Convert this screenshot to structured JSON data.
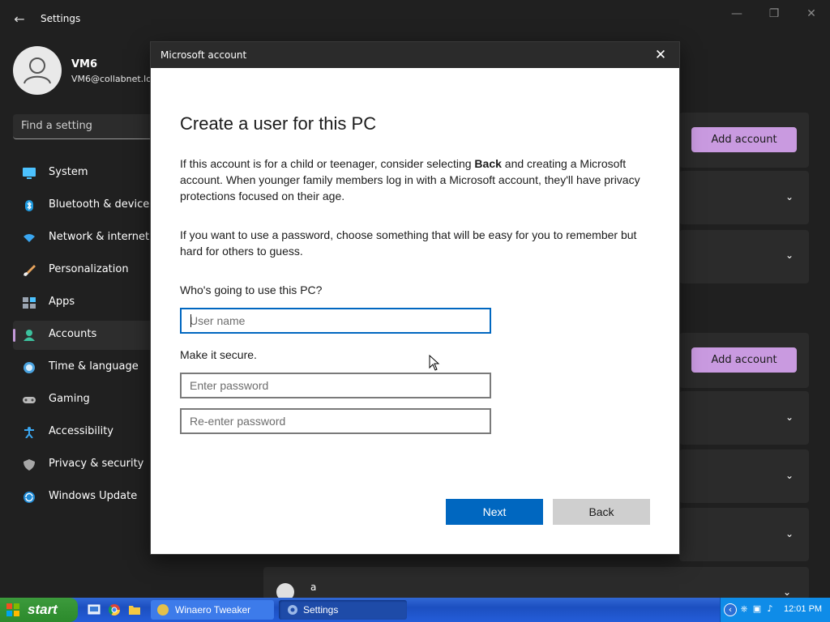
{
  "window": {
    "title": "Settings",
    "back_icon": "back-arrow-icon"
  },
  "profile": {
    "name": "VM6",
    "email": "VM6@collabnet.lo"
  },
  "search": {
    "placeholder": "Find a setting"
  },
  "sidebar": {
    "active_indicator_color": "#c39ad9",
    "items": [
      {
        "label": "System",
        "icon": "system-icon"
      },
      {
        "label": "Bluetooth & devices",
        "icon": "bluetooth-icon"
      },
      {
        "label": "Network & internet",
        "icon": "network-icon"
      },
      {
        "label": "Personalization",
        "icon": "personalization-icon"
      },
      {
        "label": "Apps",
        "icon": "apps-icon"
      },
      {
        "label": "Accounts",
        "icon": "accounts-icon",
        "active": true
      },
      {
        "label": "Time & language",
        "icon": "time-icon"
      },
      {
        "label": "Gaming",
        "icon": "gaming-icon"
      },
      {
        "label": "Accessibility",
        "icon": "accessibility-icon"
      },
      {
        "label": "Privacy & security",
        "icon": "privacy-icon"
      },
      {
        "label": "Windows Update",
        "icon": "update-icon"
      }
    ]
  },
  "main": {
    "add_account_label": "Add account",
    "add_account_color": "#c99ae0",
    "bottom_user_name": "a"
  },
  "dialog": {
    "title": "Microsoft account",
    "heading": "Create a user for this PC",
    "para1_before": "If this account is for a child or teenager, consider selecting ",
    "para1_bold": "Back",
    "para1_after": " and creating a Microsoft account. When younger family members log in with a Microsoft account, they'll have privacy protections focused on their age.",
    "para2": "If you want to use a password, choose something that will be easy for you to remember but hard for others to guess.",
    "who_label": "Who's going to use this PC?",
    "username_placeholder": "User name",
    "secure_label": "Make it secure.",
    "password_placeholder": "Enter password",
    "repassword_placeholder": "Re-enter password",
    "next_label": "Next",
    "back_label": "Back",
    "accent_color": "#0067c0"
  },
  "taskbar": {
    "start_label": "start",
    "tasks": [
      {
        "label": "Winaero Tweaker",
        "icon": "winaero-icon"
      },
      {
        "label": "Settings",
        "icon": "settings-gear-icon",
        "active": true
      }
    ],
    "clock": "12:01 PM"
  }
}
